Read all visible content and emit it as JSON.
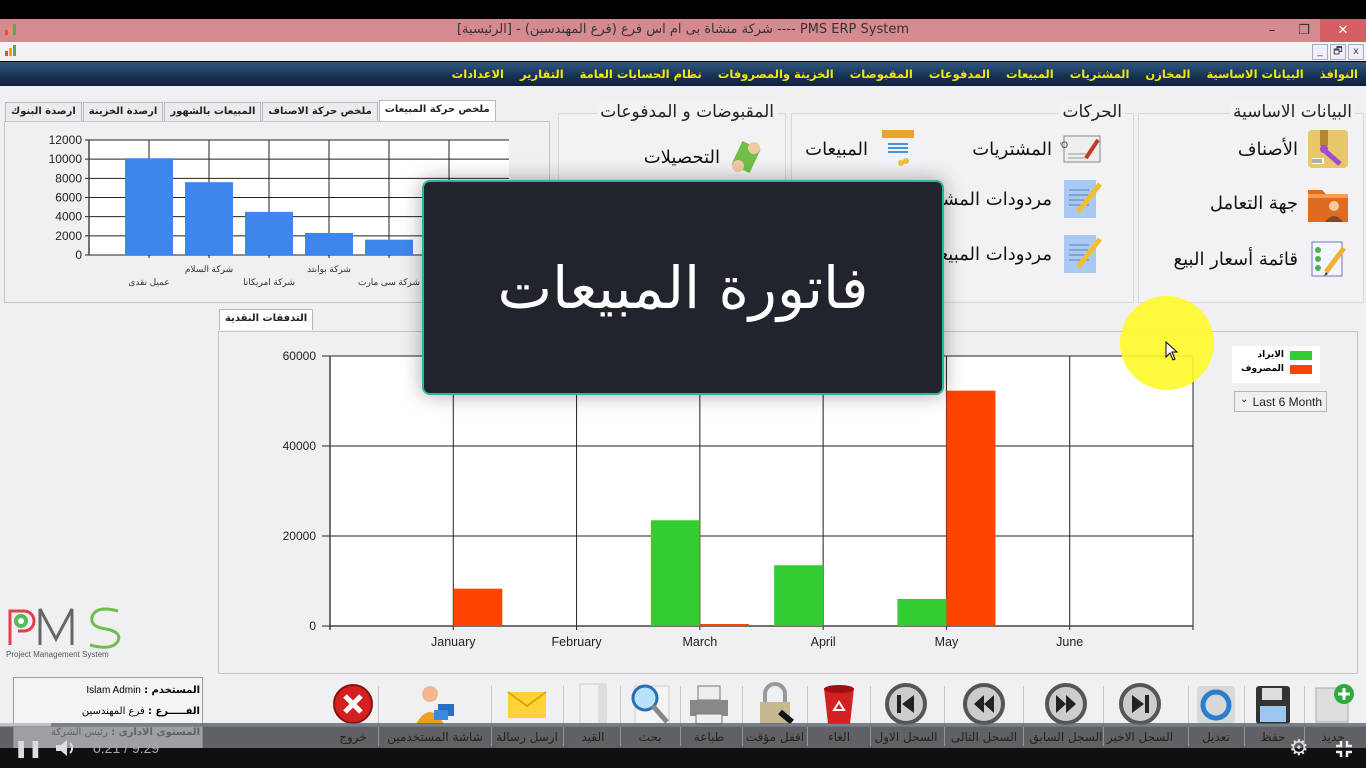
{
  "window": {
    "title": "PMS ERP System ----  شركة منشاة بى ام اس فرع (فرع المهندسين) - [الرئيسية]",
    "minimize": "–",
    "restore": "❐",
    "close": "✕",
    "mdi_minimize": "_",
    "mdi_restore": "🗗",
    "mdi_close": "x"
  },
  "menu": {
    "items": [
      "النوافذ",
      "البيانات الاساسية",
      "المخازن",
      "المشتريات",
      "المبيعات",
      "المدفوعات",
      "المقبوضات",
      "الخزينة والمصروفات",
      "نظام الحسابات العامة",
      "التقارير",
      "الاعدادات"
    ]
  },
  "groups": {
    "basic": {
      "title": "البيانات الاساسية",
      "items": [
        {
          "label": "الأصناف",
          "icon": "items-box-icon"
        },
        {
          "label": "جهة التعامل",
          "icon": "contact-folder-icon"
        },
        {
          "label": "قائمة أسعار البيع",
          "icon": "price-list-icon"
        }
      ]
    },
    "transactions": {
      "title": "الحركات",
      "items": [
        {
          "label": "المشتريات",
          "icon": "purchase-order-icon"
        },
        {
          "label": "المبيعات",
          "icon": "sales-invoice-icon"
        },
        {
          "label": "مردودات المشتريات",
          "icon": "purchase-returns-icon"
        },
        {
          "label": "مردودات المبيعات",
          "icon": "sales-returns-icon"
        }
      ]
    },
    "receipts": {
      "title": "المقبوضات و المدفوعات",
      "items": [
        {
          "label": "التحصيلات",
          "icon": "money-collect-icon"
        }
      ]
    }
  },
  "top_tabs": {
    "items": [
      "ملخص حركة المبيعات",
      "ملخص حركة الاصناف",
      "المبيعات بالشهور",
      "ارصدة الخزينة",
      "ارصدة البنوك"
    ],
    "active": 0
  },
  "cash_tab": {
    "label": "التدفقات النقدية"
  },
  "chart_data": [
    {
      "type": "bar",
      "title": "ملخص حركة المبيعات",
      "categories": [
        "عميل نقدى",
        "شركة السلام",
        "شركة امريكانا",
        "شركة بوابتد",
        "شركة سى مارت"
      ],
      "values": [
        10100,
        7600,
        4500,
        2300,
        1600
      ],
      "ylim": [
        0,
        12000
      ],
      "yticks": [
        "12000",
        "10000",
        "8000",
        "6000",
        "4000",
        "2000",
        "0"
      ],
      "grid": true,
      "color": "#3f86ec"
    },
    {
      "type": "bar",
      "title": "التدفقات النقدية",
      "categories": [
        "January",
        "February",
        "March",
        "April",
        "May",
        "June"
      ],
      "series": [
        {
          "name": "الايراد",
          "color": "#33cc33",
          "values": [
            0,
            0,
            23500,
            13500,
            6000,
            0
          ]
        },
        {
          "name": "المصروف",
          "color": "#ff4400",
          "values": [
            8300,
            0,
            300,
            0,
            52300,
            0
          ]
        }
      ],
      "ylim": [
        0,
        60000
      ],
      "yticks": [
        "60000",
        "40000",
        "20000",
        "0"
      ],
      "grid": true,
      "legend_position": "top-right"
    }
  ],
  "filter": {
    "selected": "Last 6 Month"
  },
  "logo": {
    "text": "PMS",
    "subtitle": "Project Management System"
  },
  "user": {
    "user_label": "المستخدم :",
    "user_value": "Islam Admin",
    "branch_label": "الفـــــرع :",
    "branch_value": "فرع المهندسين",
    "level_label": "المستوى الادارى :",
    "level_value": "رئيس الشركة"
  },
  "toolbar": {
    "items": [
      {
        "label": "جديد",
        "icon": "new-icon"
      },
      {
        "label": "حفظ",
        "icon": "save-icon"
      },
      {
        "label": "تعديل",
        "icon": "edit-icon"
      },
      {
        "label": "السجل الاخير",
        "icon": "last-record-icon"
      },
      {
        "label": "السجل السابق",
        "icon": "previous-record-icon"
      },
      {
        "label": "السجل التالى",
        "icon": "next-record-icon"
      },
      {
        "label": "السجل الاول",
        "icon": "first-record-icon"
      },
      {
        "label": "الغاء",
        "icon": "cancel-icon"
      },
      {
        "label": "اقفل مؤقت",
        "icon": "lock-icon"
      },
      {
        "label": "طباعة",
        "icon": "print-icon"
      },
      {
        "label": "بحث",
        "icon": "search-icon"
      },
      {
        "label": "القيد",
        "icon": "journal-icon"
      },
      {
        "label": "ارسل رسالة",
        "icon": "mail-icon"
      },
      {
        "label": "شاشة المستخدمين",
        "icon": "users-icon"
      },
      {
        "label": "خروج",
        "icon": "exit-icon"
      }
    ]
  },
  "caption": {
    "text": "فاتورة المبيعات"
  },
  "video": {
    "time": "0:21 / 9:29",
    "progress": 0.037
  }
}
